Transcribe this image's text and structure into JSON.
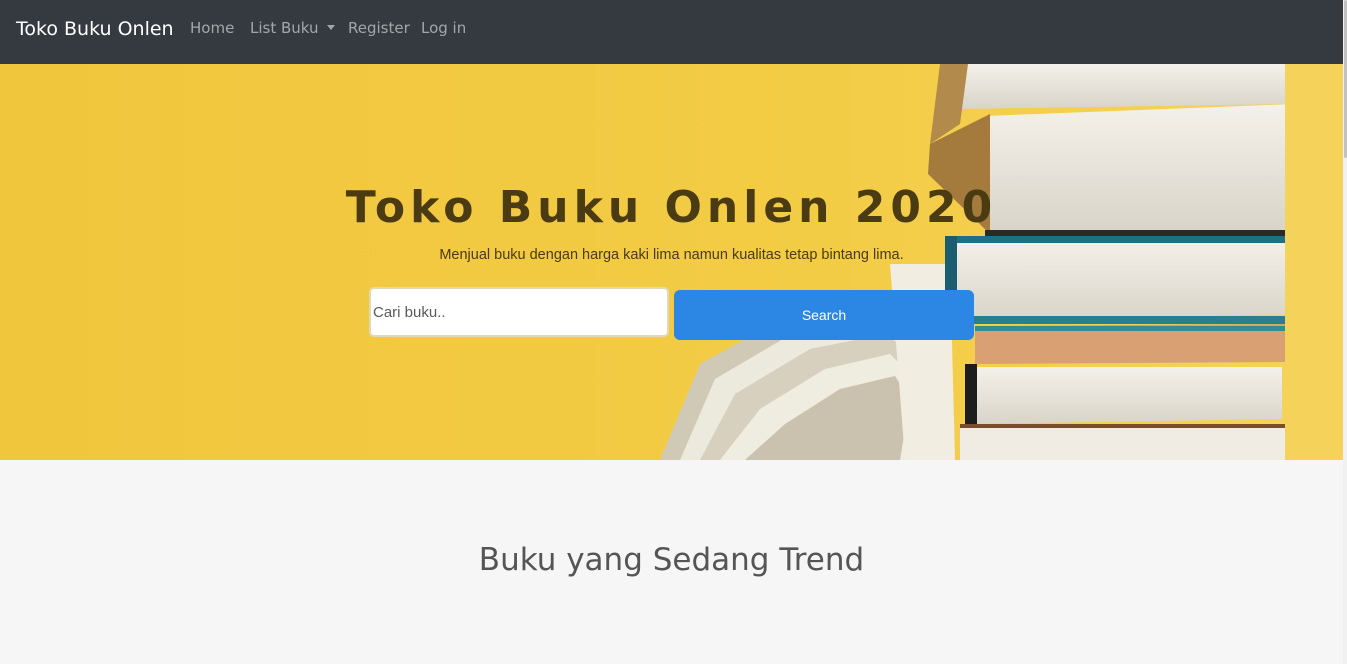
{
  "navbar": {
    "brand": "Toko Buku Onlen",
    "items": [
      {
        "label": "Home"
      },
      {
        "label": "List Buku"
      },
      {
        "label": "Register"
      },
      {
        "label": "Log in"
      }
    ],
    "background": "#343a40"
  },
  "hero": {
    "title": "Toko Buku Onlen 2020",
    "subtitle": "Menjual buku dengan harga kaki lima namun kualitas tetap bintang lima.",
    "search_placeholder": "Cari buku..",
    "search_button": "Search",
    "background_color": "#f1c93f",
    "button_color": "#2b86e4"
  },
  "section": {
    "trending_title": "Buku yang Sedang Trend"
  }
}
